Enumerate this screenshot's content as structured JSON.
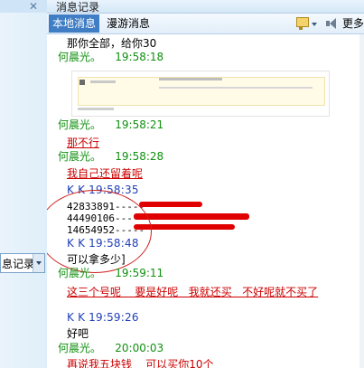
{
  "window": {
    "title": "消息记录"
  },
  "tabs": [
    {
      "label": "本地消息",
      "active": true
    },
    {
      "label": "漫游消息",
      "active": false
    }
  ],
  "toolbar": {
    "more_label": "更多"
  },
  "left": {
    "history_select_value": "息记录"
  },
  "messages": {
    "m1_text": "那你全部，给你30",
    "m2_sender": "何晨光。",
    "m2_time": "19:58:18",
    "m3_sender": "何晨光。",
    "m3_time": "19:58:21",
    "m3_text": "那不行",
    "m4_sender": "何晨光。",
    "m4_time": "19:58:28",
    "m4_text": "我自己还留着呢",
    "m5_sender": "K  K",
    "m5_time": "19:58:35",
    "m5_numbers": [
      "42833891-----",
      "44490106-----",
      "14654952-----"
    ],
    "m6_sender": "K  K",
    "m6_time": "19:58:48",
    "m6_text": "可以拿多少]",
    "m7_sender": "何晨光。",
    "m7_time": "19:59:11",
    "m7_text": "这三个号呢    要是好呢   我就还买   不好呢就不买了",
    "m8_sender": "K  K",
    "m8_time": "19:59:26",
    "m8_text": "好吧",
    "m9_sender": "何晨光。",
    "m9_time": "20:00:03",
    "m9_text": "再说我五块钱    可以买你10个"
  },
  "colors": {
    "sender_self": "#109010",
    "sender_other": "#2040b8",
    "accent_tab": "#3f7dc4",
    "annotation_red": "#cc0000"
  }
}
